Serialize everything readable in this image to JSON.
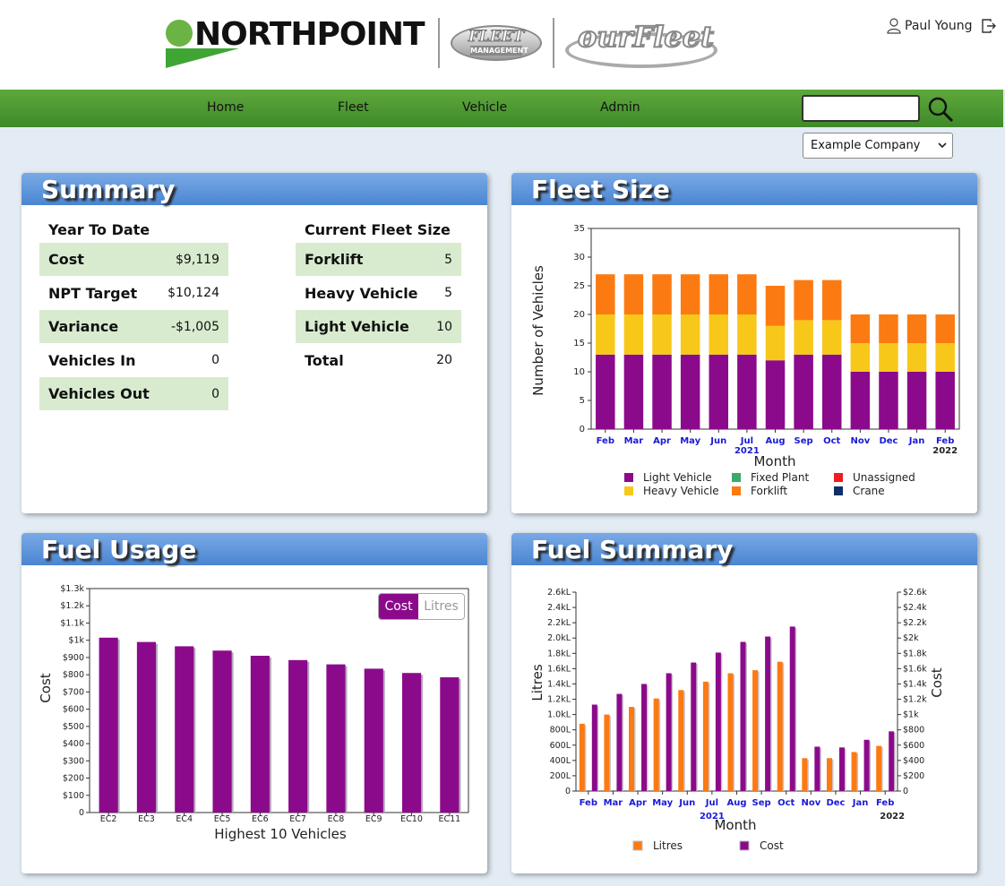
{
  "header": {
    "brand": "NORTHPOINT",
    "fleet_mgmt_line1": "FLEET",
    "fleet_mgmt_line2": "MANAGEMENT",
    "ourfleet": "ourFleet",
    "user_name": "Paul Young"
  },
  "nav": {
    "items": [
      {
        "label": "Home"
      },
      {
        "label": "Fleet"
      },
      {
        "label": "Vehicle"
      },
      {
        "label": "Admin"
      }
    ],
    "search_value": "",
    "company_selected": "Example Company"
  },
  "colors": {
    "nav_green": "#4a9a33",
    "panel_blue": "#5b8fd8",
    "row_shade": "#d8ebcf",
    "purple": "#8b0a8b",
    "gold": "#f7c81a",
    "orange": "#fc7a12"
  },
  "summary": {
    "title": "Summary",
    "ytd": {
      "heading": "Year To Date",
      "rows": [
        {
          "label": "Cost",
          "value": "$9,119"
        },
        {
          "label": "NPT Target",
          "value": "$10,124"
        },
        {
          "label": "Variance",
          "value": "-$1,005"
        },
        {
          "label": "Vehicles In",
          "value": "0"
        },
        {
          "label": "Vehicles Out",
          "value": "0"
        }
      ]
    },
    "fleet": {
      "heading": "Current Fleet Size",
      "rows": [
        {
          "label": "Forklift",
          "value": "5"
        },
        {
          "label": "Heavy Vehicle",
          "value": "5"
        },
        {
          "label": "Light Vehicle",
          "value": "10"
        },
        {
          "label": "Total",
          "value": "20"
        }
      ]
    }
  },
  "fleet_size_panel": {
    "title": "Fleet Size"
  },
  "fuel_usage_panel": {
    "title": "Fuel Usage",
    "toggle": [
      {
        "label": "Cost",
        "active": true
      },
      {
        "label": "Litres",
        "active": false
      }
    ]
  },
  "fuel_summary_panel": {
    "title": "Fuel Summary"
  },
  "chart_data": [
    {
      "id": "fleet-size",
      "type": "bar",
      "stacked": true,
      "categories": [
        "Feb",
        "Mar",
        "Apr",
        "May",
        "Jun",
        "Jul",
        "Aug",
        "Sep",
        "Oct",
        "Nov",
        "Dec",
        "Jan",
        "Feb"
      ],
      "year_labels": [
        {
          "text": "2021",
          "at": 5
        },
        {
          "text": "2022",
          "at": 12
        }
      ],
      "xlabel": "Month",
      "ylabel": "Number of Vehicles",
      "ylim": [
        0,
        35
      ],
      "yticks": [
        0,
        5,
        10,
        15,
        20,
        25,
        30,
        35
      ],
      "series": [
        {
          "name": "Light Vehicle",
          "color": "#8b0a8b",
          "values": [
            13,
            13,
            13,
            13,
            13,
            13,
            12,
            13,
            13,
            10,
            10,
            10,
            10
          ]
        },
        {
          "name": "Heavy Vehicle",
          "color": "#f7c81a",
          "values": [
            7,
            7,
            7,
            7,
            7,
            7,
            6,
            6,
            6,
            5,
            5,
            5,
            5
          ]
        },
        {
          "name": "Forklift",
          "color": "#fc7a12",
          "values": [
            7,
            7,
            7,
            7,
            7,
            7,
            7,
            7,
            7,
            5,
            5,
            5,
            5
          ]
        },
        {
          "name": "Fixed Plant",
          "color": "#3aaa6a",
          "values": [
            0,
            0,
            0,
            0,
            0,
            0,
            0,
            0,
            0,
            0,
            0,
            0,
            0
          ]
        },
        {
          "name": "Unassigned",
          "color": "#ee1c1c",
          "values": [
            0,
            0,
            0,
            0,
            0,
            0,
            0,
            0,
            0,
            0,
            0,
            0,
            0
          ]
        },
        {
          "name": "Crane",
          "color": "#0d2f66",
          "values": [
            0,
            0,
            0,
            0,
            0,
            0,
            0,
            0,
            0,
            0,
            0,
            0,
            0
          ]
        }
      ],
      "legend_order": [
        "Light Vehicle",
        "Fixed Plant",
        "Unassigned",
        "Heavy Vehicle",
        "Forklift",
        "Crane"
      ],
      "legend_placement": "bottom",
      "grid": false
    },
    {
      "id": "fuel-usage",
      "type": "bar",
      "categories": [
        "EC2",
        "EC3",
        "EC4",
        "EC5",
        "EC6",
        "EC7",
        "EC8",
        "EC9",
        "EC10",
        "EC11"
      ],
      "values": [
        1015,
        990,
        965,
        940,
        910,
        885,
        860,
        835,
        810,
        785
      ],
      "color": "#8b0a8b",
      "xlabel": "Highest 10 Vehicles",
      "ylabel": "Cost",
      "ylim": [
        0,
        1300
      ],
      "yticks": [
        0,
        100,
        200,
        300,
        400,
        500,
        600,
        700,
        800,
        900,
        1000,
        1100,
        1200,
        1300
      ],
      "ytick_labels": [
        "0",
        "$100",
        "$200",
        "$300",
        "$400",
        "$500",
        "$600",
        "$700",
        "$800",
        "$900",
        "$1k",
        "$1.1k",
        "$1.2k",
        "$1.3k"
      ],
      "grid": false
    },
    {
      "id": "fuel-summary",
      "type": "bar",
      "categories": [
        "Feb",
        "Mar",
        "Apr",
        "May",
        "Jun",
        "Jul",
        "Aug",
        "Sep",
        "Oct",
        "Nov",
        "Dec",
        "Jan",
        "Feb"
      ],
      "year_labels": [
        {
          "text": "2021",
          "at": 5
        },
        {
          "text": "2022",
          "at": 12
        }
      ],
      "xlabel": "Month",
      "ylabel_left": "Litres",
      "ylabel_right": "Cost",
      "ylim_left": [
        0,
        2600
      ],
      "ylim_right": [
        0,
        2600
      ],
      "yticks": [
        0,
        200,
        400,
        600,
        800,
        1000,
        1200,
        1400,
        1600,
        1800,
        2000,
        2200,
        2400,
        2600
      ],
      "ytick_labels_left": [
        "0",
        "200L",
        "400L",
        "600L",
        "800L",
        "1.0kL",
        "1.2kL",
        "1.4kL",
        "1.6kL",
        "1.8kL",
        "2.0kL",
        "2.2kL",
        "2.4kL",
        "2.6kL"
      ],
      "ytick_labels_right": [
        "0",
        "$200",
        "$400",
        "$600",
        "$800",
        "$1k",
        "$1.2k",
        "$1.4k",
        "$1.6k",
        "$1.8k",
        "$2k",
        "$2.2k",
        "$2.4k",
        "$2.6k"
      ],
      "series": [
        {
          "name": "Litres",
          "color": "#fc7a12",
          "values": [
            880,
            1000,
            1100,
            1210,
            1320,
            1430,
            1540,
            1580,
            1690,
            430,
            430,
            510,
            590
          ]
        },
        {
          "name": "Cost",
          "color": "#8b0a8b",
          "values": [
            1130,
            1270,
            1400,
            1540,
            1680,
            1810,
            1950,
            2020,
            2150,
            580,
            570,
            670,
            780
          ]
        }
      ],
      "legend_placement": "bottom",
      "grid": false
    }
  ]
}
